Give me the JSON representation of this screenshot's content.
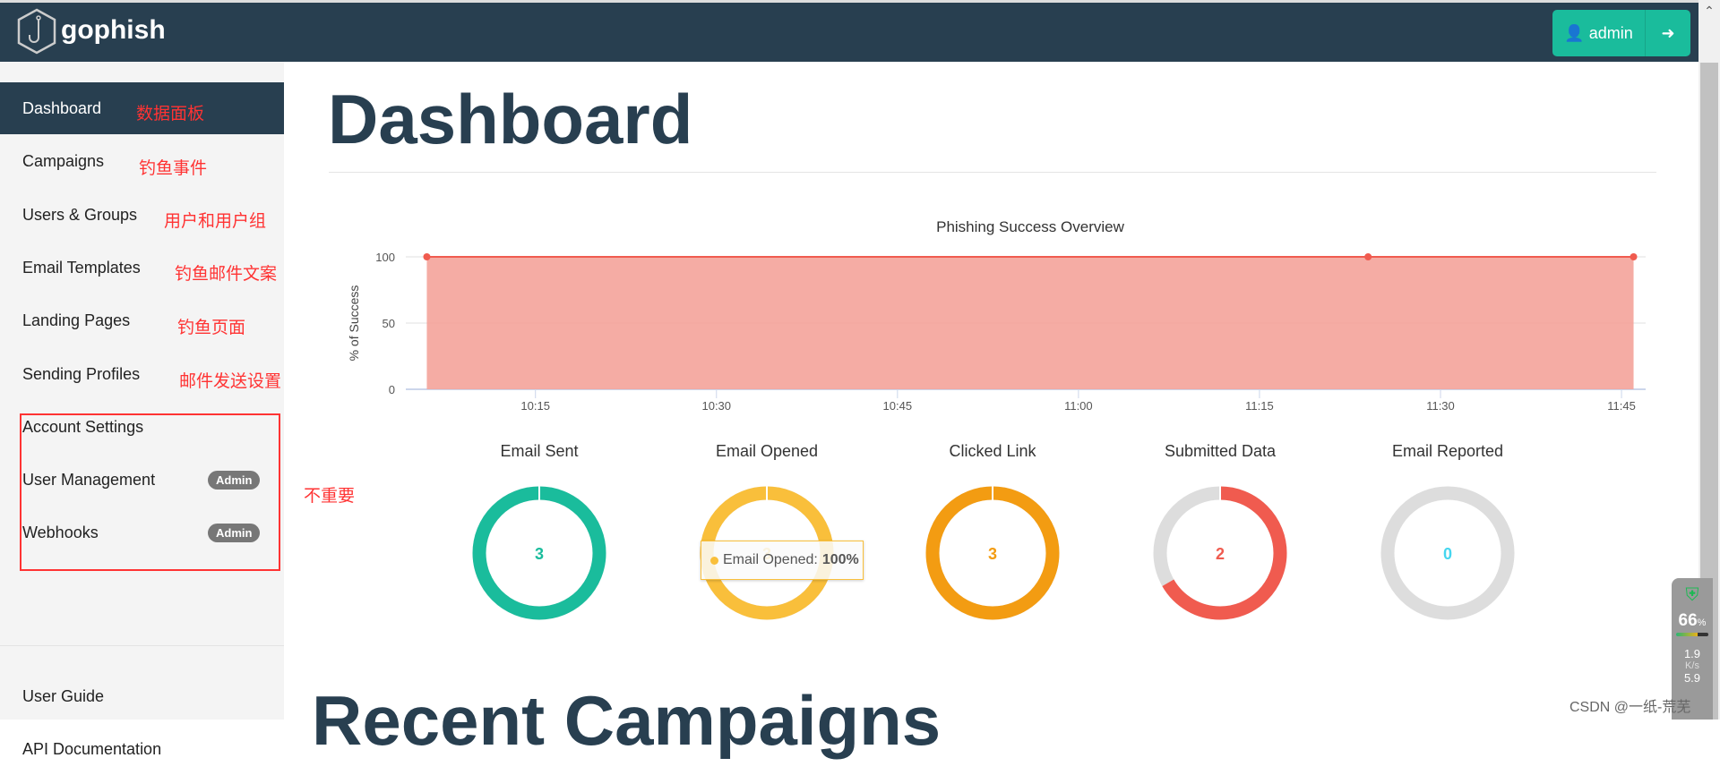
{
  "navbar": {
    "brand": "gophish",
    "user_label": "admin",
    "user_icon": "user-icon",
    "logout_icon": "sign-out-icon"
  },
  "sidebar": {
    "items": [
      {
        "label": "Dashboard",
        "active": true
      },
      {
        "label": "Campaigns"
      },
      {
        "label": "Users & Groups"
      },
      {
        "label": "Email Templates"
      },
      {
        "label": "Landing Pages"
      },
      {
        "label": "Sending Profiles"
      },
      {
        "label": "Account Settings"
      },
      {
        "label": "User Management",
        "badge": "Admin"
      },
      {
        "label": "Webhooks",
        "badge": "Admin"
      },
      {
        "label": "User Guide"
      },
      {
        "label": "API Documentation"
      }
    ]
  },
  "annotations": [
    "数据面板",
    "钓鱼事件",
    "用户和用户组",
    "钓鱼邮件文案",
    "钓鱼页面",
    "邮件发送设置",
    "不重要"
  ],
  "main": {
    "title": "Dashboard",
    "recent_title": "Recent Campaigns"
  },
  "chart_data": [
    {
      "type": "area",
      "title": "Phishing Success Overview",
      "ylabel": "% of Success",
      "xlabel": "",
      "x": [
        "10:06",
        "11:24",
        "11:46"
      ],
      "values": [
        100,
        100,
        100
      ],
      "xticks": [
        "10:15",
        "10:30",
        "10:45",
        "11:00",
        "11:15",
        "11:30",
        "11:45"
      ],
      "yticks": [
        0,
        50,
        100
      ],
      "ylim": [
        0,
        100
      ],
      "xlim": [
        "10:05",
        "11:47"
      ],
      "grid": true,
      "color": "#f4a39a",
      "line_color": "#f05b4f"
    },
    {
      "type": "pie",
      "donuts": [
        {
          "label": "Email Sent",
          "value": 3,
          "percent": 100,
          "color": "#1abc9c"
        },
        {
          "label": "Email Opened",
          "value": 3,
          "percent": 100,
          "color": "#f9bf3b"
        },
        {
          "label": "Clicked Link",
          "value": 3,
          "percent": 100,
          "color": "#f39c12"
        },
        {
          "label": "Submitted Data",
          "value": 2,
          "percent": 66.7,
          "color": "#f05b4f"
        },
        {
          "label": "Email Reported",
          "value": 0,
          "percent": 0,
          "color": "#45d6ef"
        }
      ],
      "empty_color": "#dddddd"
    }
  ],
  "tooltip": {
    "label": "Email Opened:",
    "value": "100%"
  },
  "widget": {
    "percent": "66",
    "unit": "%",
    "speed1": "1.9",
    "speed_unit": "K/s",
    "speed2": "5.9"
  },
  "watermark": "CSDN @一纸-荒芜"
}
